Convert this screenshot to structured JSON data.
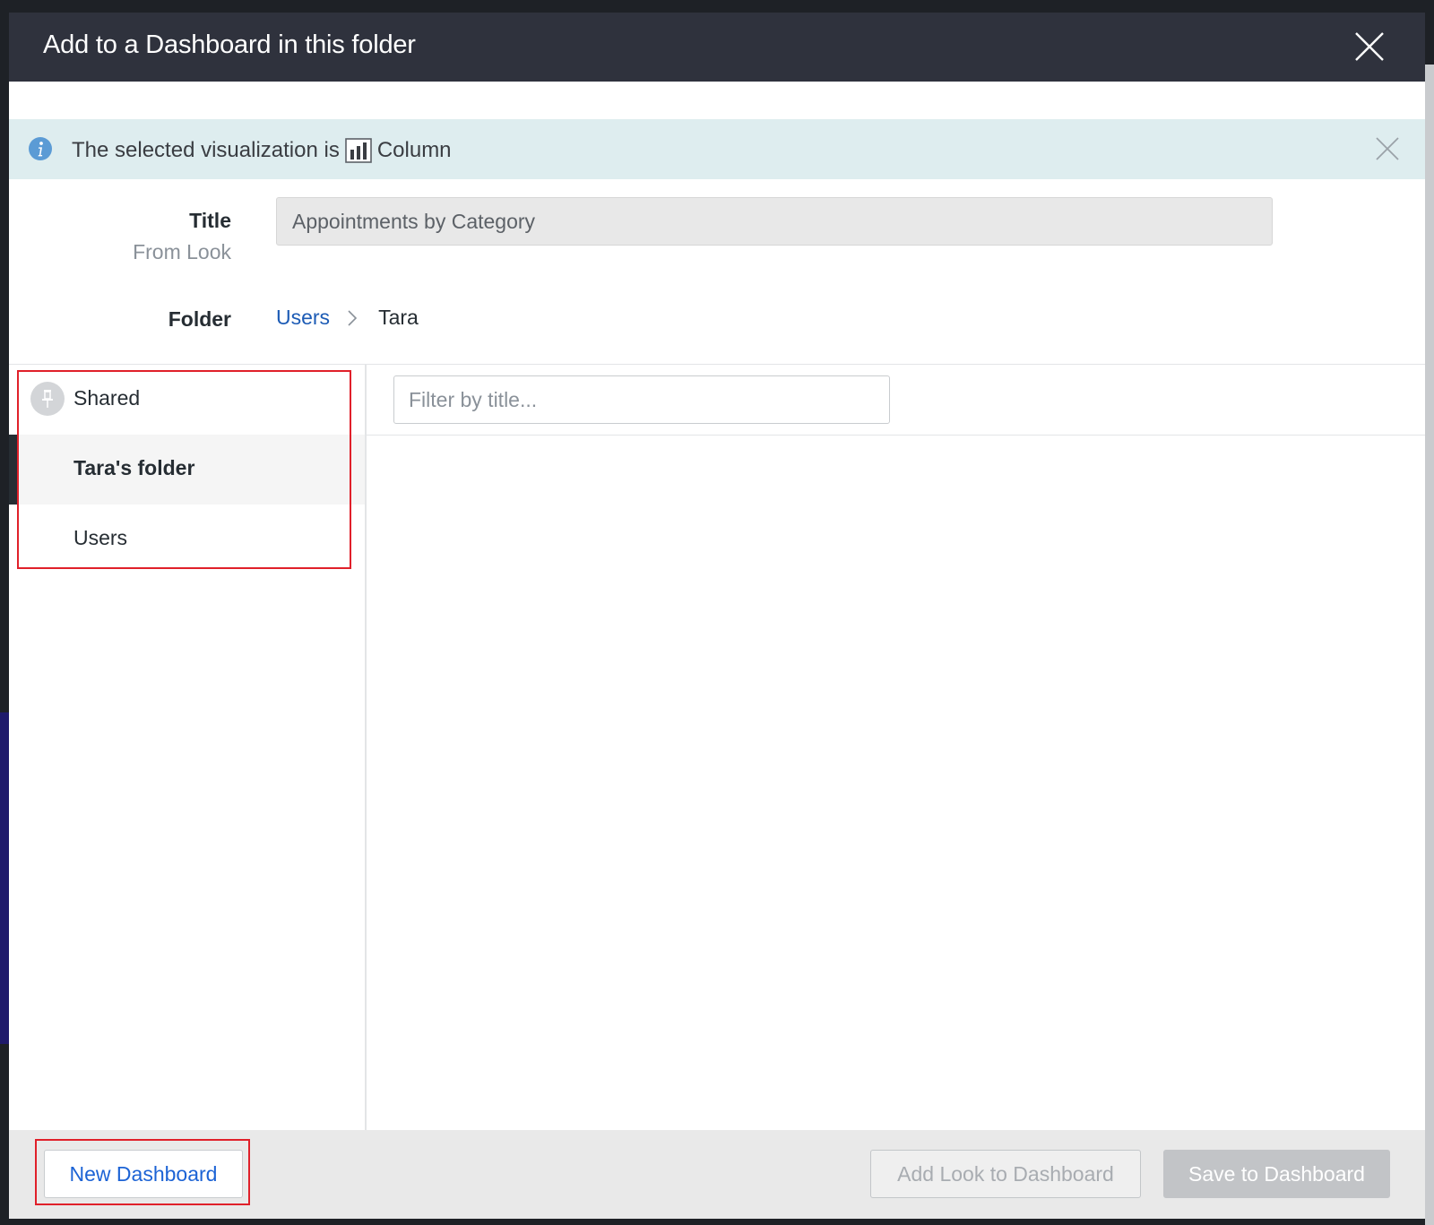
{
  "modal": {
    "title": "Add to a Dashboard in this folder"
  },
  "info_bar": {
    "text_prefix": "The selected visualization is",
    "viz_type": "Column",
    "icon": "info-icon",
    "viz_icon": "column-chart-icon"
  },
  "form": {
    "title_label": "Title",
    "title_sublabel": "From Look",
    "title_value": "Appointments by Category",
    "folder_label": "Folder",
    "breadcrumb": {
      "parent": "Users",
      "current": "Tara"
    }
  },
  "sidebar": {
    "items": [
      {
        "label": "Shared",
        "icon": "pin-icon",
        "selected": false
      },
      {
        "label": "Tara's folder",
        "selected": true
      },
      {
        "label": "Users",
        "selected": false
      }
    ]
  },
  "filter": {
    "placeholder": "Filter by title..."
  },
  "footer": {
    "new_dashboard_label": "New Dashboard",
    "add_look_label": "Add Look to Dashboard",
    "save_label": "Save to Dashboard"
  },
  "colors": {
    "header_bg": "#2f323d",
    "info_bg": "#deedef",
    "link": "#1c5bb5",
    "highlight": "#e0202a"
  }
}
